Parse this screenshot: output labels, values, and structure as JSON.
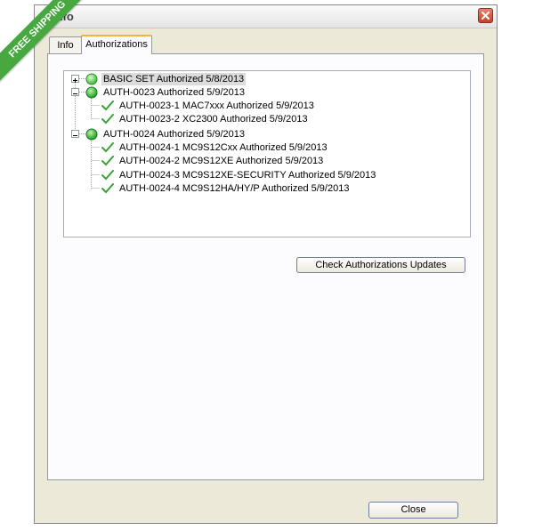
{
  "promo_ribbon": {
    "text": "FREE SHIPPING",
    "color": "#46a83e"
  },
  "window": {
    "title": "Info",
    "close_icon": "close-icon"
  },
  "tabs": [
    {
      "label": "Info"
    },
    {
      "label": "Authorizations",
      "active": true
    }
  ],
  "tree": {
    "nodes": [
      {
        "label": "BASIC SET Authorized 5/8/2013",
        "level": 0,
        "icon": "green-circle-icon",
        "expander": "expand",
        "selected": true
      },
      {
        "label": "AUTH-0023 Authorized 5/9/2013",
        "level": 0,
        "icon": "green-sphere-icon",
        "expander": "collapse"
      },
      {
        "label": "AUTH-0023-1 MAC7xxx Authorized 5/9/2013",
        "level": 1,
        "icon": "checkmark-icon"
      },
      {
        "label": "AUTH-0023-2 XC2300 Authorized 5/9/2013",
        "level": 1,
        "icon": "checkmark-icon"
      },
      {
        "label": "AUTH-0024 Authorized 5/9/2013",
        "level": 0,
        "icon": "green-sphere-icon",
        "expander": "collapse"
      },
      {
        "label": "AUTH-0024-1 MC9S12Cxx Authorized 5/9/2013",
        "level": 1,
        "icon": "checkmark-icon"
      },
      {
        "label": "AUTH-0024-2 MC9S12XE Authorized 5/9/2013",
        "level": 1,
        "icon": "checkmark-icon"
      },
      {
        "label": "AUTH-0024-3 MC9S12XE-SECURITY Authorized 5/9/2013",
        "level": 1,
        "icon": "checkmark-icon"
      },
      {
        "label": "AUTH-0024-4 MC9S12HA/HY/P Authorized 5/9/2013",
        "level": 1,
        "icon": "checkmark-icon"
      }
    ]
  },
  "buttons": {
    "check_updates": "Check Authorizations Updates",
    "close": "Close"
  },
  "colors": {
    "check_green": "#3aa13a",
    "sphere_green": "#2fb52f",
    "window_bg": "#ece9d8",
    "tab_highlight": "#f8b33c"
  }
}
